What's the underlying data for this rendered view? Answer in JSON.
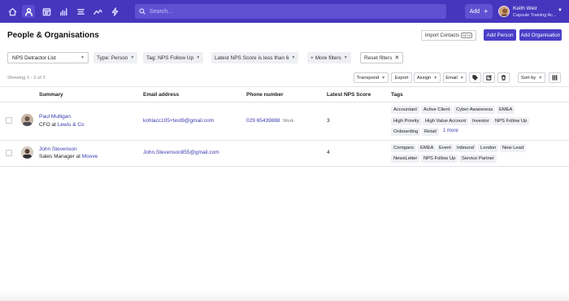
{
  "search": {
    "placeholder": "Search..."
  },
  "header": {
    "add_label": "Add",
    "user_name": "Keith Weir",
    "user_org": "Capsule Training Ac..."
  },
  "page": {
    "title": "People & Organisations",
    "import_label": "Import Contacts",
    "beta_label": "BETA",
    "add_person": "Add Person",
    "add_org": "Add Organisation"
  },
  "filters": {
    "list": "NPS Detractor List",
    "type_label": "Type:",
    "type_value": "Person",
    "tag_label": "Tag:",
    "tag_value": "NPS Follow Up",
    "score_label": "Latest NPS Score is less than",
    "score_value": "6",
    "more": "+ More filters",
    "reset": "Reset filters"
  },
  "toolbar": {
    "showing": "Showing 1 - 2 of 2",
    "transpond": "Transpond",
    "export": "Export",
    "assign": "Assign",
    "email": "Email",
    "sort": "Sort by"
  },
  "columns": [
    "Summary",
    "Email address",
    "Phone number",
    "Latest NPS Score",
    "Tags"
  ],
  "rows": [
    {
      "name": "Paul Mulligan",
      "title": "CFO at",
      "org": "Lewis & Co",
      "email": "kohlacc105+test9@gmail.com",
      "phone": "029 65439888",
      "phone_type": "Work",
      "score": "3",
      "tags": [
        "Accountant",
        "Active Client",
        "Cyber Awareness",
        "EMEA",
        "High Priority",
        "High Value Account",
        "Investor",
        "NPS Follow Up",
        "Onboarding",
        "Retail"
      ],
      "more": "1 more"
    },
    {
      "name": "John Stevenson",
      "title": "Sales Manager at",
      "org": "Moove",
      "email": "John.Stevenson855@gmail.com",
      "phone": "",
      "phone_type": "",
      "score": "4",
      "tags": [
        "Corrigans",
        "EMEA",
        "Event",
        "Inbound",
        "London",
        "New Lead",
        "NewsLetter",
        "NPS Follow Up",
        "Service Partner"
      ],
      "more": ""
    }
  ],
  "colors": {
    "nav": "#4536bd",
    "primary": "#4a3ec8",
    "link": "#3b3ab0"
  }
}
